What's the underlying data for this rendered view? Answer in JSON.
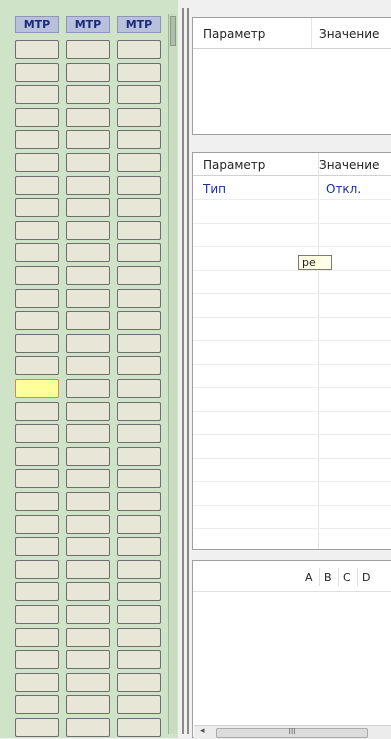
{
  "mtp_grid": {
    "columns": [
      "МТР",
      "МТР",
      "МТР"
    ],
    "row_count": 31,
    "selected": {
      "row": 15,
      "col": 0
    }
  },
  "props_panel_top": {
    "headers": [
      "Параметр",
      "Значение"
    ]
  },
  "props_panel_mid": {
    "headers": [
      "Параметр",
      "Значение"
    ],
    "rows": [
      {
        "param": "Тип",
        "value": "Откл."
      }
    ],
    "tooltip": "ре"
  },
  "bottom_panel": {
    "column_letters": [
      "A",
      "B",
      "C",
      "D"
    ],
    "scroll_grip": "III"
  },
  "colors": {
    "left_background": "#cfe3c8",
    "header_bg": "#b8c0dc",
    "cell_bg": "#e8e6d6",
    "selected_cell": "#ffff9a",
    "value_text": "#1a2ea0"
  }
}
